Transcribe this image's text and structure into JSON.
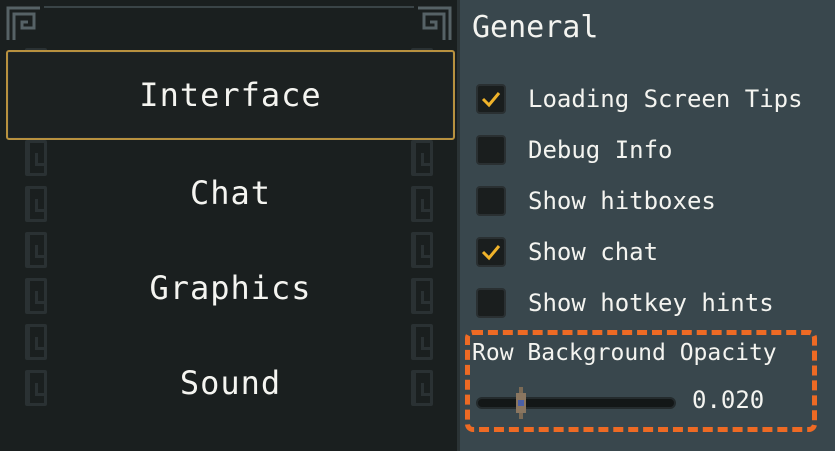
{
  "menu": {
    "items": [
      {
        "label": "Interface",
        "active": true
      },
      {
        "label": "Chat",
        "active": false
      },
      {
        "label": "Graphics",
        "active": false
      },
      {
        "label": "Sound",
        "active": false
      }
    ]
  },
  "settings": {
    "section_title": "General",
    "options": [
      {
        "label": "Loading Screen Tips",
        "checked": true
      },
      {
        "label": "Debug Info",
        "checked": false
      },
      {
        "label": "Show hitboxes",
        "checked": false
      },
      {
        "label": "Show chat",
        "checked": true
      },
      {
        "label": "Show hotkey hints",
        "checked": false
      }
    ],
    "slider": {
      "label": "Row Background Opacity",
      "value": "0.020",
      "fraction": 0.22
    }
  },
  "colors": {
    "accent_gold": "#b8913f",
    "checkmark": "#f0b32a",
    "highlight": "#ee6a24"
  }
}
